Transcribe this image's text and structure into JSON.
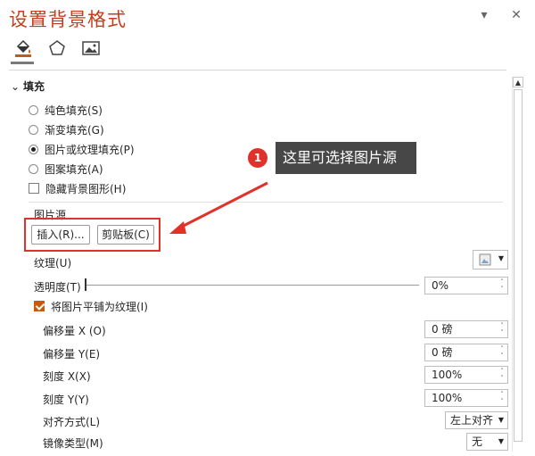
{
  "panel": {
    "title": "设置背景格式",
    "dropdown_icon": "chevron-down-icon",
    "close_icon": "close-icon"
  },
  "tabs": [
    {
      "icon": "paint-bucket-icon",
      "active": true
    },
    {
      "icon": "pentagon-icon",
      "active": false
    },
    {
      "icon": "picture-icon",
      "active": false
    }
  ],
  "fill": {
    "section_label": "填充",
    "options": [
      {
        "label": "纯色填充(S)",
        "checked": false
      },
      {
        "label": "渐变填充(G)",
        "checked": false
      },
      {
        "label": "图片或纹理填充(P)",
        "checked": true
      },
      {
        "label": "图案填充(A)",
        "checked": false
      }
    ],
    "hide_bg_label": "隐藏背景图形(H)",
    "source_label": "图片源",
    "insert_label": "插入(R)...",
    "clipboard_label": "剪贴板(C)",
    "texture_label": "纹理(U)",
    "transparency_label": "透明度(T)",
    "transparency_value": "0%",
    "tile_label": "将图片平铺为纹理(I)",
    "offset_x_label": "偏移量 X (O)",
    "offset_x_value": "0 磅",
    "offset_y_label": "偏移量 Y(E)",
    "offset_y_value": "0 磅",
    "scale_x_label": "刻度 X(X)",
    "scale_x_value": "100%",
    "scale_y_label": "刻度 Y(Y)",
    "scale_y_value": "100%",
    "align_label": "对齐方式(L)",
    "align_value": "左上对齐",
    "mirror_label": "镜像类型(M)",
    "mirror_value": "无"
  },
  "annotation": {
    "badge": "1",
    "text": "这里可选择图片源",
    "color": "#e0312b"
  },
  "colors": {
    "title": "#c43e1c",
    "checkbox_accent": "#c55a11",
    "callout_bg": "#474747"
  }
}
